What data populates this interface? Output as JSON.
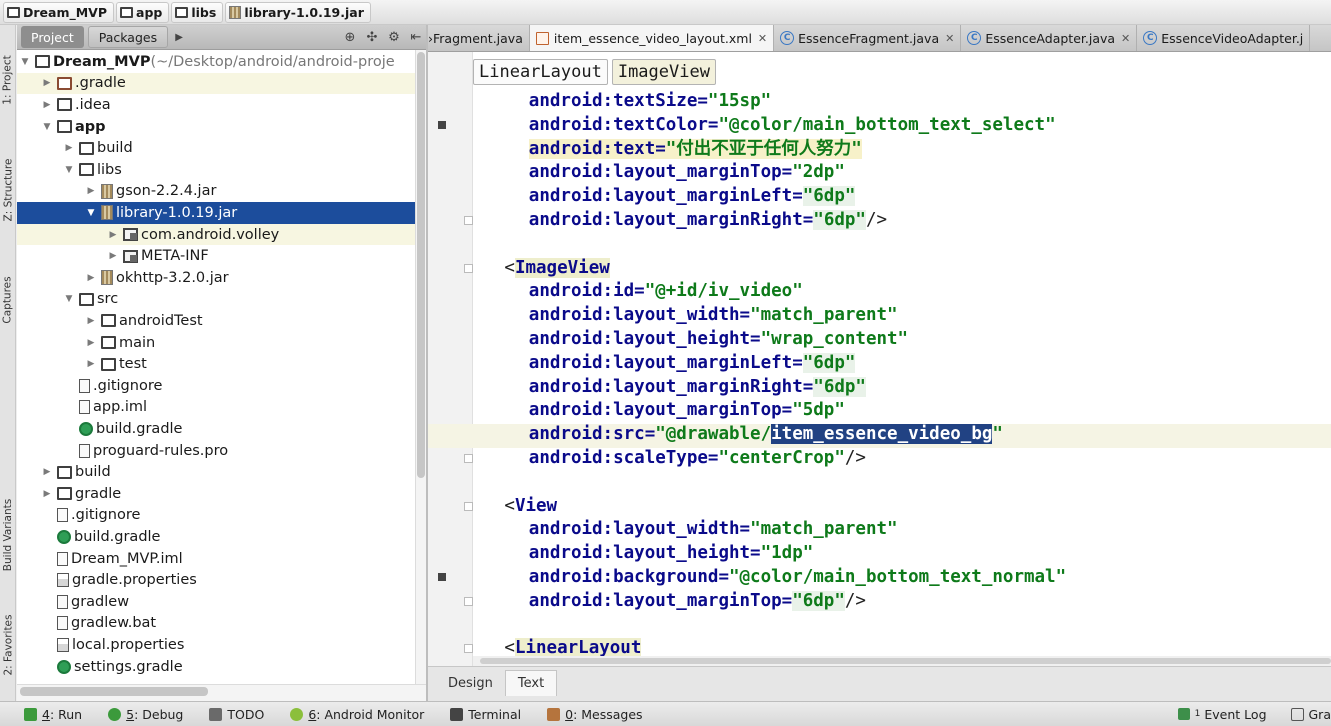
{
  "breadcrumb": [
    "Dream_MVP",
    "app",
    "libs",
    "library-1.0.19.jar"
  ],
  "left_stripe": [
    "1: Project",
    "Z: Structure",
    "Captures",
    "Build Variants",
    "2: Favorites"
  ],
  "panel_tabs": {
    "project": "Project",
    "packages": "Packages"
  },
  "tree": [
    {
      "label": "Dream_MVP",
      "suffix": " (~/Desktop/android/android-proje",
      "depth": 0,
      "caret": "down",
      "icon": "folder-bold"
    },
    {
      "label": ".gradle",
      "depth": 1,
      "caret": "right",
      "icon": "folder-brown",
      "hl": true
    },
    {
      "label": ".idea",
      "depth": 1,
      "caret": "right",
      "icon": "folder"
    },
    {
      "label": "app",
      "depth": 1,
      "caret": "down",
      "icon": "module"
    },
    {
      "label": "build",
      "depth": 2,
      "caret": "right",
      "icon": "folder"
    },
    {
      "label": "libs",
      "depth": 2,
      "caret": "down",
      "icon": "folder"
    },
    {
      "label": "gson-2.2.4.jar",
      "depth": 3,
      "caret": "right",
      "icon": "jar"
    },
    {
      "label": "library-1.0.19.jar",
      "depth": 3,
      "caret": "down",
      "icon": "jar",
      "selected": true
    },
    {
      "label": "com.android.volley",
      "depth": 4,
      "caret": "right",
      "icon": "package",
      "hl": true
    },
    {
      "label": "META-INF",
      "depth": 4,
      "caret": "right",
      "icon": "package"
    },
    {
      "label": "okhttp-3.2.0.jar",
      "depth": 3,
      "caret": "right",
      "icon": "jar"
    },
    {
      "label": "src",
      "depth": 2,
      "caret": "down",
      "icon": "folder"
    },
    {
      "label": "androidTest",
      "depth": 3,
      "caret": "right",
      "icon": "folder"
    },
    {
      "label": "main",
      "depth": 3,
      "caret": "right",
      "icon": "folder"
    },
    {
      "label": "test",
      "depth": 3,
      "caret": "right",
      "icon": "folder"
    },
    {
      "label": ".gitignore",
      "depth": 2,
      "caret": "",
      "icon": "file"
    },
    {
      "label": "app.iml",
      "depth": 2,
      "caret": "",
      "icon": "file"
    },
    {
      "label": "build.gradle",
      "depth": 2,
      "caret": "",
      "icon": "gradle"
    },
    {
      "label": "proguard-rules.pro",
      "depth": 2,
      "caret": "",
      "icon": "file"
    },
    {
      "label": "build",
      "depth": 1,
      "caret": "right",
      "icon": "folder"
    },
    {
      "label": "gradle",
      "depth": 1,
      "caret": "right",
      "icon": "folder"
    },
    {
      "label": ".gitignore",
      "depth": 1,
      "caret": "",
      "icon": "file"
    },
    {
      "label": "build.gradle",
      "depth": 1,
      "caret": "",
      "icon": "gradle"
    },
    {
      "label": "Dream_MVP.iml",
      "depth": 1,
      "caret": "",
      "icon": "file"
    },
    {
      "label": "gradle.properties",
      "depth": 1,
      "caret": "",
      "icon": "props"
    },
    {
      "label": "gradlew",
      "depth": 1,
      "caret": "",
      "icon": "file"
    },
    {
      "label": "gradlew.bat",
      "depth": 1,
      "caret": "",
      "icon": "file"
    },
    {
      "label": "local.properties",
      "depth": 1,
      "caret": "",
      "icon": "props"
    },
    {
      "label": "settings.gradle",
      "depth": 1,
      "caret": "",
      "icon": "gradle"
    }
  ],
  "editor_tabs": [
    {
      "label": "›Fragment.java",
      "icon": "class",
      "close": false
    },
    {
      "label": "item_essence_video_layout.xml",
      "icon": "xml",
      "active": true,
      "close": true
    },
    {
      "label": "EssenceFragment.java",
      "icon": "class",
      "close": true
    },
    {
      "label": "EssenceAdapter.java",
      "icon": "class",
      "close": true
    },
    {
      "label": "EssenceVideoAdapter.j",
      "icon": "class",
      "close": false
    }
  ],
  "xml_breadcrumb": [
    "LinearLayout",
    "ImageView"
  ],
  "code_lines": [
    {
      "indent": 4,
      "parts": [
        [
          "attr",
          "android:textSize="
        ],
        [
          "val",
          "\"15sp\""
        ]
      ]
    },
    {
      "indent": 4,
      "marker": true,
      "parts": [
        [
          "attr",
          "android:textColor="
        ],
        [
          "val",
          "\"@color/main_bottom_text_select\""
        ]
      ]
    },
    {
      "indent": 4,
      "parts": [
        [
          "attr hlbg",
          "android:text="
        ],
        [
          "val hlbg",
          "\"付出不亚于任何人努力\""
        ]
      ]
    },
    {
      "indent": 4,
      "parts": [
        [
          "attr",
          "android:layout_marginTop="
        ],
        [
          "val",
          "\"2dp\""
        ]
      ]
    },
    {
      "indent": 4,
      "parts": [
        [
          "attr",
          "android:layout_marginLeft="
        ],
        [
          "val dp",
          "\"6dp\""
        ]
      ]
    },
    {
      "indent": 4,
      "fold": true,
      "parts": [
        [
          "attr",
          "android:layout_marginRight="
        ],
        [
          "val dp",
          "\"6dp\""
        ],
        [
          "ang",
          "/>"
        ]
      ]
    },
    {
      "indent": 0,
      "parts": []
    },
    {
      "indent": 2,
      "fold": true,
      "parts": [
        [
          "ang",
          "<"
        ],
        [
          "tag tagbg",
          "ImageView"
        ]
      ]
    },
    {
      "indent": 4,
      "parts": [
        [
          "attr",
          "android:id="
        ],
        [
          "val",
          "\"@+id/iv_video\""
        ]
      ]
    },
    {
      "indent": 4,
      "parts": [
        [
          "attr",
          "android:layout_width="
        ],
        [
          "val",
          "\"match_parent\""
        ]
      ]
    },
    {
      "indent": 4,
      "parts": [
        [
          "attr",
          "android:layout_height="
        ],
        [
          "val",
          "\"wrap_content\""
        ]
      ]
    },
    {
      "indent": 4,
      "parts": [
        [
          "attr",
          "android:layout_marginLeft="
        ],
        [
          "val dp",
          "\"6dp\""
        ]
      ]
    },
    {
      "indent": 4,
      "parts": [
        [
          "attr",
          "android:layout_marginRight="
        ],
        [
          "val dp",
          "\"6dp\""
        ]
      ]
    },
    {
      "indent": 4,
      "parts": [
        [
          "attr",
          "android:layout_marginTop="
        ],
        [
          "val",
          "\"5dp\""
        ]
      ]
    },
    {
      "indent": 4,
      "parts": [
        [
          "attr",
          "android:src="
        ],
        [
          "val",
          "\"@drawable/"
        ],
        [
          "val selbg",
          "item_essence_video_bg"
        ],
        [
          "val",
          "\""
        ]
      ]
    },
    {
      "indent": 4,
      "fold": true,
      "parts": [
        [
          "attr",
          "android:scaleType="
        ],
        [
          "val",
          "\"centerCrop\""
        ],
        [
          "ang",
          "/>"
        ]
      ]
    },
    {
      "indent": 0,
      "parts": []
    },
    {
      "indent": 2,
      "fold": true,
      "parts": [
        [
          "ang",
          "<"
        ],
        [
          "tag",
          "View"
        ]
      ]
    },
    {
      "indent": 4,
      "parts": [
        [
          "attr",
          "android:layout_width="
        ],
        [
          "val",
          "\"match_parent\""
        ]
      ]
    },
    {
      "indent": 4,
      "parts": [
        [
          "attr",
          "android:layout_height="
        ],
        [
          "val",
          "\"1dp\""
        ]
      ]
    },
    {
      "indent": 4,
      "marker": true,
      "parts": [
        [
          "attr",
          "android:background="
        ],
        [
          "val",
          "\"@color/main_bottom_text_normal\""
        ]
      ]
    },
    {
      "indent": 4,
      "fold": true,
      "parts": [
        [
          "attr",
          "android:layout_marginTop="
        ],
        [
          "val dp",
          "\"6dp\""
        ],
        [
          "ang",
          "/>"
        ]
      ]
    },
    {
      "indent": 0,
      "parts": []
    },
    {
      "indent": 2,
      "fold": true,
      "parts": [
        [
          "ang",
          "<"
        ],
        [
          "tag tagbg",
          "LinearLayout"
        ]
      ]
    }
  ],
  "design_tabs": {
    "design": "Design",
    "text": "Text"
  },
  "status_bar": [
    {
      "key": "4",
      "label": ": Run",
      "icon": "run-icon"
    },
    {
      "key": "5",
      "label": ": Debug",
      "icon": "debug-icon"
    },
    {
      "key": "",
      "label": "TODO",
      "icon": "todo-icon"
    },
    {
      "key": "6",
      "label": ": Android Monitor",
      "icon": "android-icon"
    },
    {
      "key": "",
      "label": "Terminal",
      "icon": "terminal-icon"
    },
    {
      "key": "0",
      "label": ": Messages",
      "icon": "messages-icon"
    }
  ],
  "status_right": {
    "event_log_num": "1",
    "event_log": "Event Log",
    "gradle": "Gra"
  },
  "colors": {
    "selection": "#1c4d9c",
    "attr": "#0a0a8a",
    "value": "#0e7a1a",
    "highlight": "#f7f1c9"
  }
}
